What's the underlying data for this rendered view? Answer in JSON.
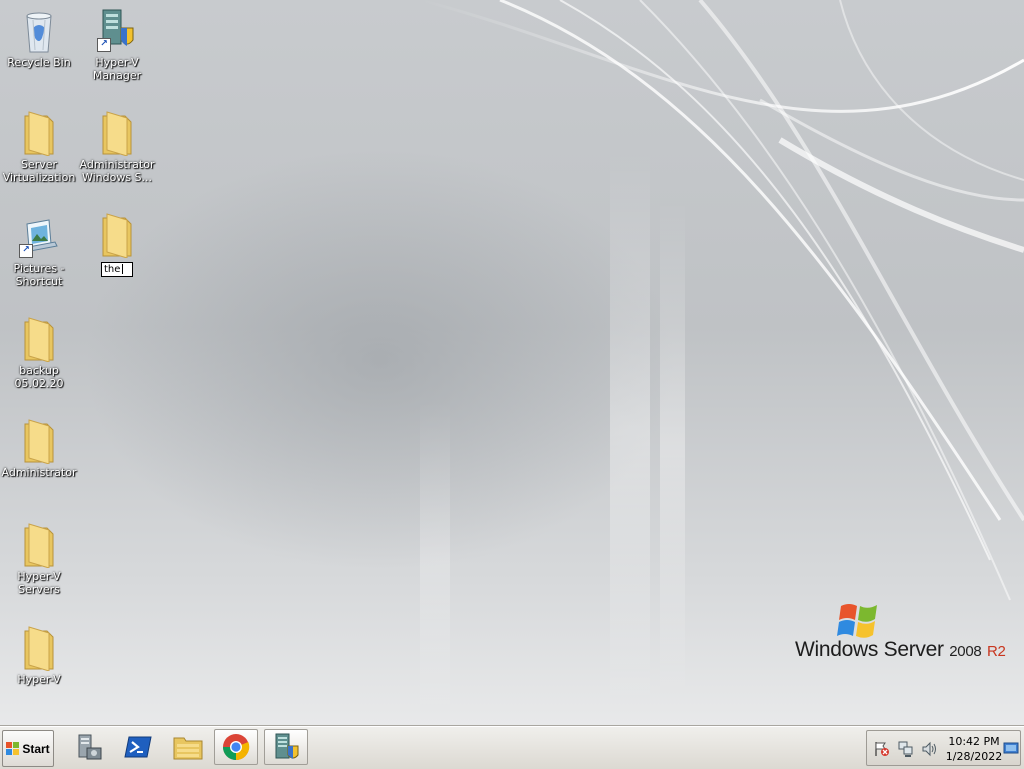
{
  "desktop": {
    "icons": [
      {
        "name": "Recycle Bin",
        "type": "recycle-bin"
      },
      {
        "name": "Hyper-V\nManager",
        "type": "app-shortcut"
      },
      {
        "name": "Server\nVirtualization",
        "type": "folder"
      },
      {
        "name": "Administrator\nWindows S...",
        "type": "folder"
      },
      {
        "name": "Pictures -\nShortcut",
        "type": "shortcut"
      },
      {
        "name": "the",
        "type": "folder",
        "renaming": true
      },
      {
        "name": "backup\n05.02.20",
        "type": "folder"
      },
      {
        "name": "Administrator",
        "type": "folder"
      },
      {
        "name": "Hyper-V\nServers",
        "type": "folder"
      },
      {
        "name": "Hyper-V",
        "type": "folder"
      }
    ]
  },
  "branding": {
    "name": "Windows Server",
    "version": "2008",
    "edition": "R2"
  },
  "taskbar": {
    "start_label": "Start",
    "pinned": [
      "server-manager-icon",
      "powershell-icon",
      "windows-explorer-icon",
      "chrome-icon",
      "hyperv-manager-icon"
    ],
    "clock": {
      "time": "10:42 PM",
      "date": "1/28/2022"
    }
  },
  "colors": {
    "r2_accent": "#c8361f",
    "folder_yellow": "#f3d57a",
    "ps_blue": "#1f5fbf"
  }
}
